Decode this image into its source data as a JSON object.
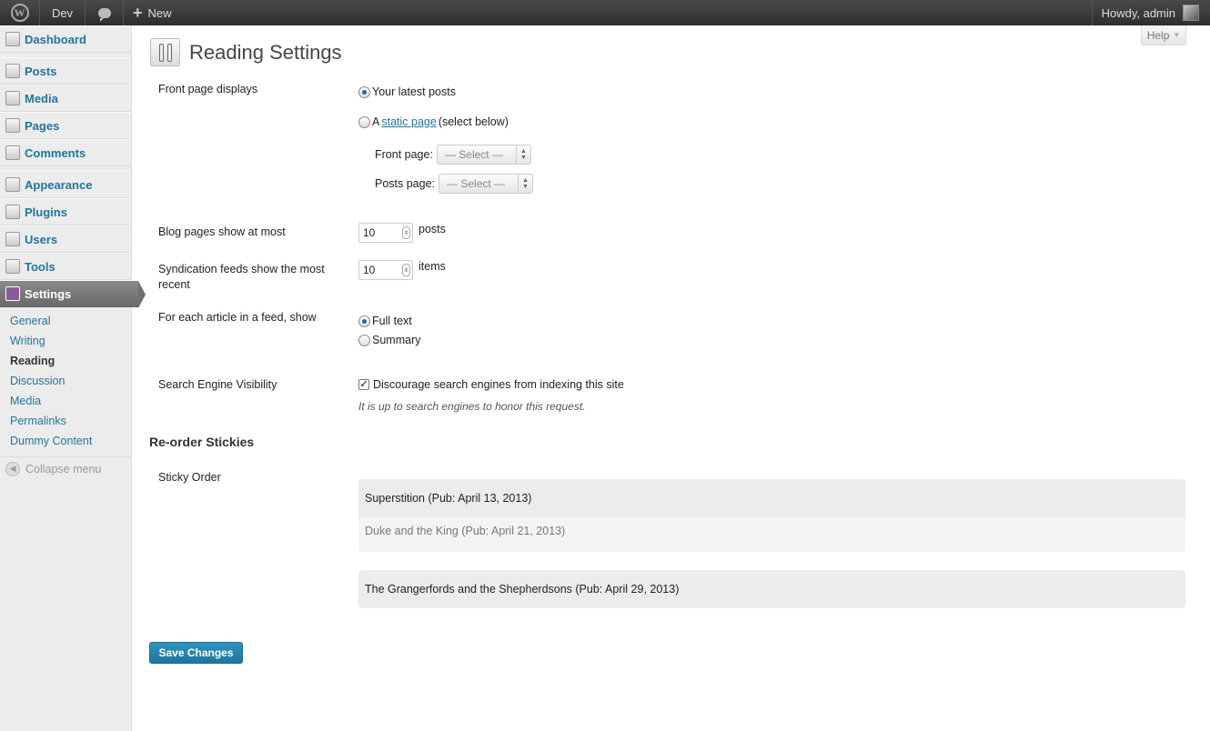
{
  "adminbar": {
    "site": "Dev",
    "new_label": "New",
    "howdy": "Howdy, admin"
  },
  "sidebar": {
    "items": [
      {
        "label": "Dashboard",
        "icon": "dashboard-icon"
      },
      {
        "label": "Posts",
        "icon": "pin-icon"
      },
      {
        "label": "Media",
        "icon": "media-icon"
      },
      {
        "label": "Pages",
        "icon": "pages-icon"
      },
      {
        "label": "Comments",
        "icon": "comments-icon"
      },
      {
        "label": "Appearance",
        "icon": "appearance-icon"
      },
      {
        "label": "Plugins",
        "icon": "plugin-icon"
      },
      {
        "label": "Users",
        "icon": "users-icon"
      },
      {
        "label": "Tools",
        "icon": "tools-icon"
      },
      {
        "label": "Settings",
        "icon": "settings-icon"
      }
    ],
    "submenu": [
      "General",
      "Writing",
      "Reading",
      "Discussion",
      "Media",
      "Permalinks",
      "Dummy Content"
    ],
    "collapse": "Collapse menu"
  },
  "help": "Help",
  "page_title": "Reading Settings",
  "front_page": {
    "label": "Front page displays",
    "latest": "Your latest posts",
    "static_prefix": "A",
    "static_link": "static page",
    "static_suffix": "(select below)",
    "front_label": "Front page:",
    "posts_label": "Posts page:",
    "select_placeholder": "— Select —"
  },
  "blog_pages": {
    "label": "Blog pages show at most",
    "value": "10",
    "unit": "posts"
  },
  "syndication": {
    "label": "Syndication feeds show the most recent",
    "value": "10",
    "unit": "items"
  },
  "feed_article": {
    "label": "For each article in a feed, show",
    "full": "Full text",
    "summary": "Summary"
  },
  "search_engine": {
    "label": "Search Engine Visibility",
    "checkbox": "Discourage search engines from indexing this site",
    "note": "It is up to search engines to honor this request."
  },
  "reorder": {
    "heading": "Re-order Stickies",
    "label": "Sticky Order",
    "items": [
      "Superstition (Pub: April 13, 2013)",
      "Duke and the King (Pub: April 21, 2013)",
      "The Grangerfords and the Shepherdsons (Pub: April 29, 2013)"
    ]
  },
  "save_label": "Save Changes"
}
